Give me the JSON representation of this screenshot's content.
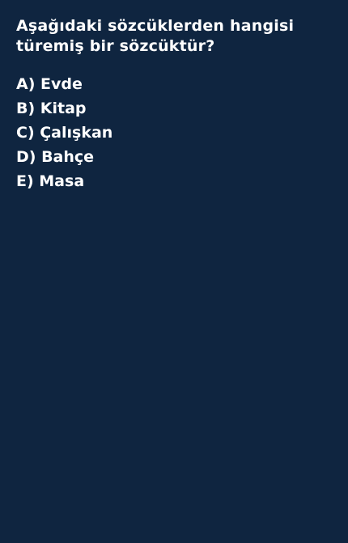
{
  "colors": {
    "background": "#0f2540",
    "text": "#ffffff"
  },
  "question": {
    "text": "Aşağıdaki sözcüklerden hangisi türemiş bir sözcüktür?"
  },
  "options": [
    {
      "label": "A) Evde"
    },
    {
      "label": "B) Kitap"
    },
    {
      "label": "C) Çalışkan"
    },
    {
      "label": "D) Bahçe"
    },
    {
      "label": "E) Masa"
    }
  ]
}
